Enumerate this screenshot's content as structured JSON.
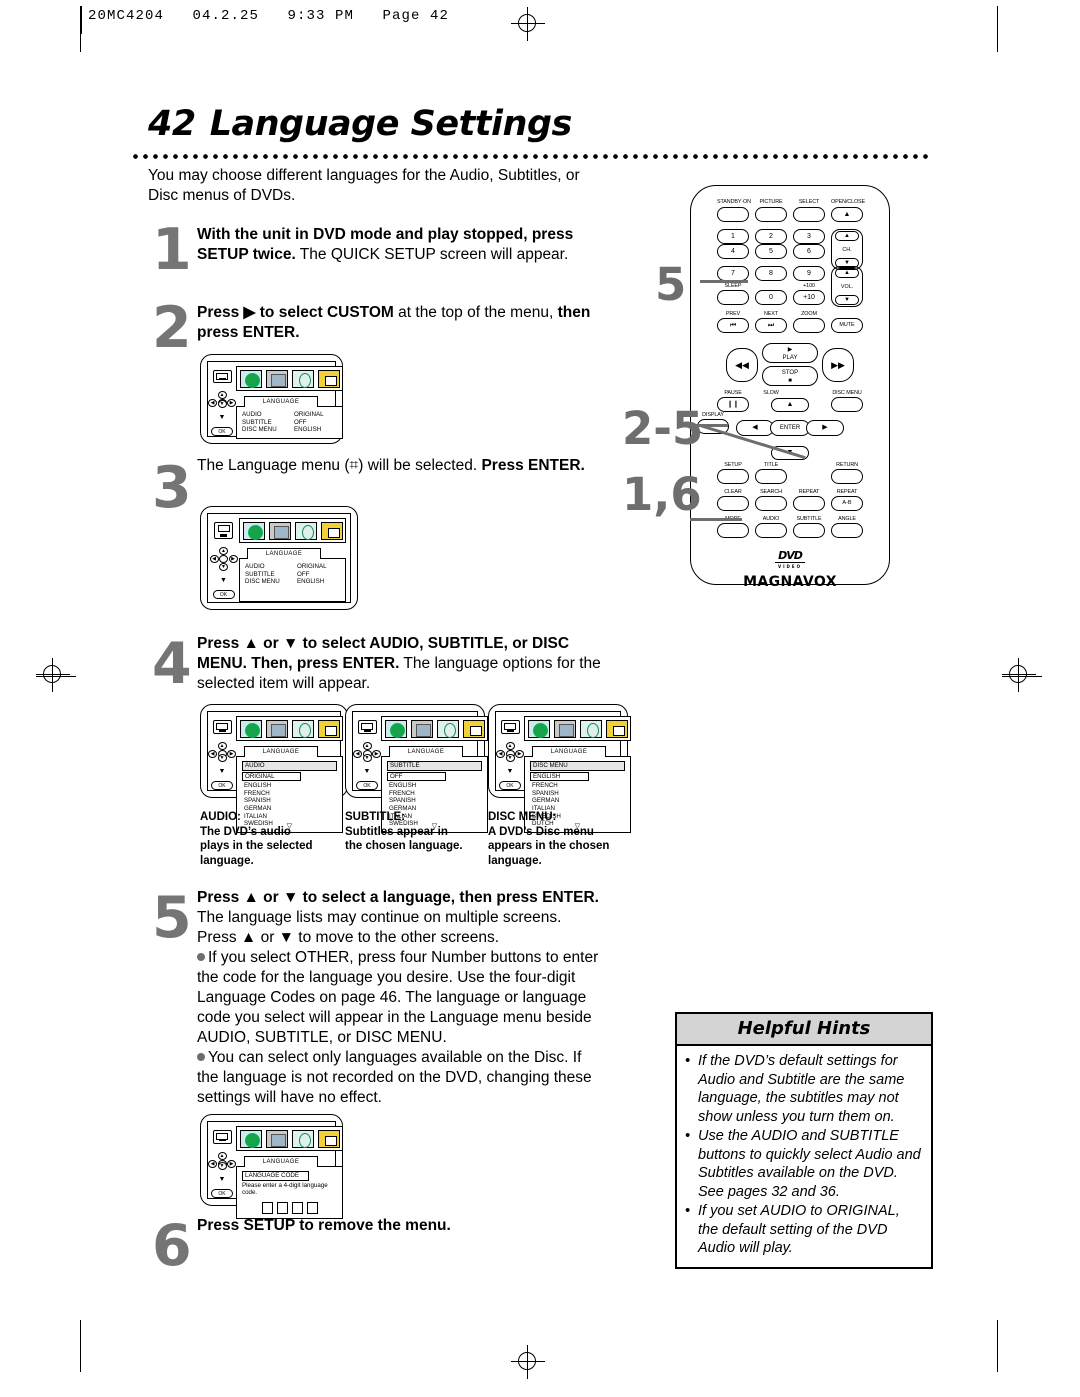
{
  "slug": "20MC4204   04.2.25   9:33 PM   Page 42",
  "page": {
    "number": "42",
    "title": "Language Settings",
    "intro": "You may choose different languages for the Audio, Subtitles, or Disc menus of DVDs."
  },
  "steps": [
    {
      "num": "1",
      "html": "<b>With the unit in DVD mode and play stopped, press SETUP twice.</b> The QUICK SETUP screen will appear."
    },
    {
      "num": "2",
      "html": "<b>Press ▶ to select CUSTOM</b> at the top of the menu, <b>then press ENTER.</b>"
    },
    {
      "num": "3",
      "html": "The Language menu (⌗) will be selected. <b>Press ENTER.</b>"
    },
    {
      "num": "4",
      "html": "<b>Press ▲ or ▼ to select AUDIO, SUBTITLE, or DISC MENU. Then, press ENTER.</b> The language options for the selected item will appear."
    },
    {
      "num": "5",
      "html": "<b>Press ▲ or ▼ to select a language, then press ENTER.</b> The language lists may continue on multiple screens. Press ▲ or ▼ to move to the other screens."
    },
    {
      "num": "6",
      "html": "<b>Press SETUP to remove the menu.</b>"
    }
  ],
  "step5_bullets": [
    "If you select OTHER, press four Number buttons to enter the code for the language you desire. Use the four-digit Language Codes on page 46. The language or language code you select will appear in the Language menu beside AUDIO, SUBTITLE, or DISC MENU.",
    "You can select only languages available on the Disc. If the language is not recorded on the DVD, changing these settings will have no effect."
  ],
  "screens": {
    "menu_tab": "LANGUAGE",
    "step2": {
      "rows": [
        {
          "key": "AUDIO",
          "value": "ORIGINAL"
        },
        {
          "key": "SUBTITLE",
          "value": "OFF"
        },
        {
          "key": "DISC MENU",
          "value": "ENGLISH"
        }
      ]
    },
    "step3": {
      "rows": [
        {
          "key": "AUDIO",
          "value": "ORIGINAL"
        },
        {
          "key": "SUBTITLE",
          "value": "OFF"
        },
        {
          "key": "DISC MENU",
          "value": "ENGLISH"
        }
      ]
    },
    "audio": {
      "header": "AUDIO",
      "selected": "ORIGINAL",
      "options": [
        "ENGLISH",
        "FRENCH",
        "SPANISH",
        "GERMAN",
        "ITALIAN",
        "SWEDISH"
      ],
      "more": "▽"
    },
    "subtitle": {
      "header": "SUBTITLE",
      "selected": "OFF",
      "options": [
        "ENGLISH",
        "FRENCH",
        "SPANISH",
        "GERMAN",
        "ITALIAN",
        "SWEDISH"
      ],
      "more": "▽"
    },
    "discmenu": {
      "header": "DISC MENU",
      "selected": "ENGLISH",
      "options": [
        "FRENCH",
        "SPANISH",
        "GERMAN",
        "ITALIAN",
        "SWEDISH",
        "DUTCH"
      ],
      "more": "▽"
    },
    "langcode": {
      "header": "LANGUAGE CODE",
      "prompt": "Please enter a 4-digit language code.",
      "boxes": 4
    },
    "ok_label": "OK"
  },
  "captions": [
    {
      "title": "AUDIO:",
      "text": "The DVD’s audio plays in the selected language."
    },
    {
      "title": "SUBTITLE:",
      "text": "Subtitles appear in the chosen language."
    },
    {
      "title": "DISC MENU:",
      "text": "A DVD’s Disc menu appears in the chosen language."
    }
  ],
  "callouts": [
    "5",
    "2-5",
    "1,6"
  ],
  "remote": {
    "brand": "MAGNAVOX",
    "logo": "DVD",
    "logo_sub": "VIDEO",
    "row_top": [
      "STANDBY·ON",
      "PICTURE",
      "SELECT",
      "OPEN/CLOSE"
    ],
    "open_close_glyph": "▲",
    "keys": [
      "1",
      "2",
      "3",
      "4",
      "5",
      "6",
      "7",
      "8",
      "9",
      "0"
    ],
    "ch_label": "CH.",
    "vol_label": "VOL.",
    "sleep": "SLEEP",
    "plus100": "+100",
    "plus10": "+10",
    "prev": "PREV",
    "next": "NEXT",
    "zoom": "ZOOM",
    "mute": "MUTE",
    "play": "PLAY",
    "stop": "STOP",
    "rew": "◀◀",
    "ff": "▶▶",
    "pause": "PAUSE",
    "slow": "SLOW",
    "disc_menu": "DISC MENU",
    "display": "DISPLAY",
    "setup": "SETUP",
    "title_btn": "TITLE",
    "return_btn": "RETURN",
    "enter": "ENTER",
    "clear": "CLEAR",
    "search_mode": "SEARCH MODE",
    "repeat": "REPEAT",
    "repeat_ab": "REPEAT",
    "repeat_ab_sub": "A-B",
    "mode": "MODE",
    "audio": "AUDIO",
    "subtitle": "SUBTITLE",
    "angle": "ANGLE"
  },
  "hints": {
    "title": "Helpful Hints",
    "items": [
      "If the DVD’s default settings for Audio and Subtitle are the same language, the subtitles may not show unless you turn them on.",
      "Use the AUDIO and SUBTITLE buttons to quickly select Audio and Subtitles available on the DVD. See pages 32 and 36.",
      "If you set AUDIO to ORIGINAL, the default setting of the DVD Audio will play."
    ]
  }
}
